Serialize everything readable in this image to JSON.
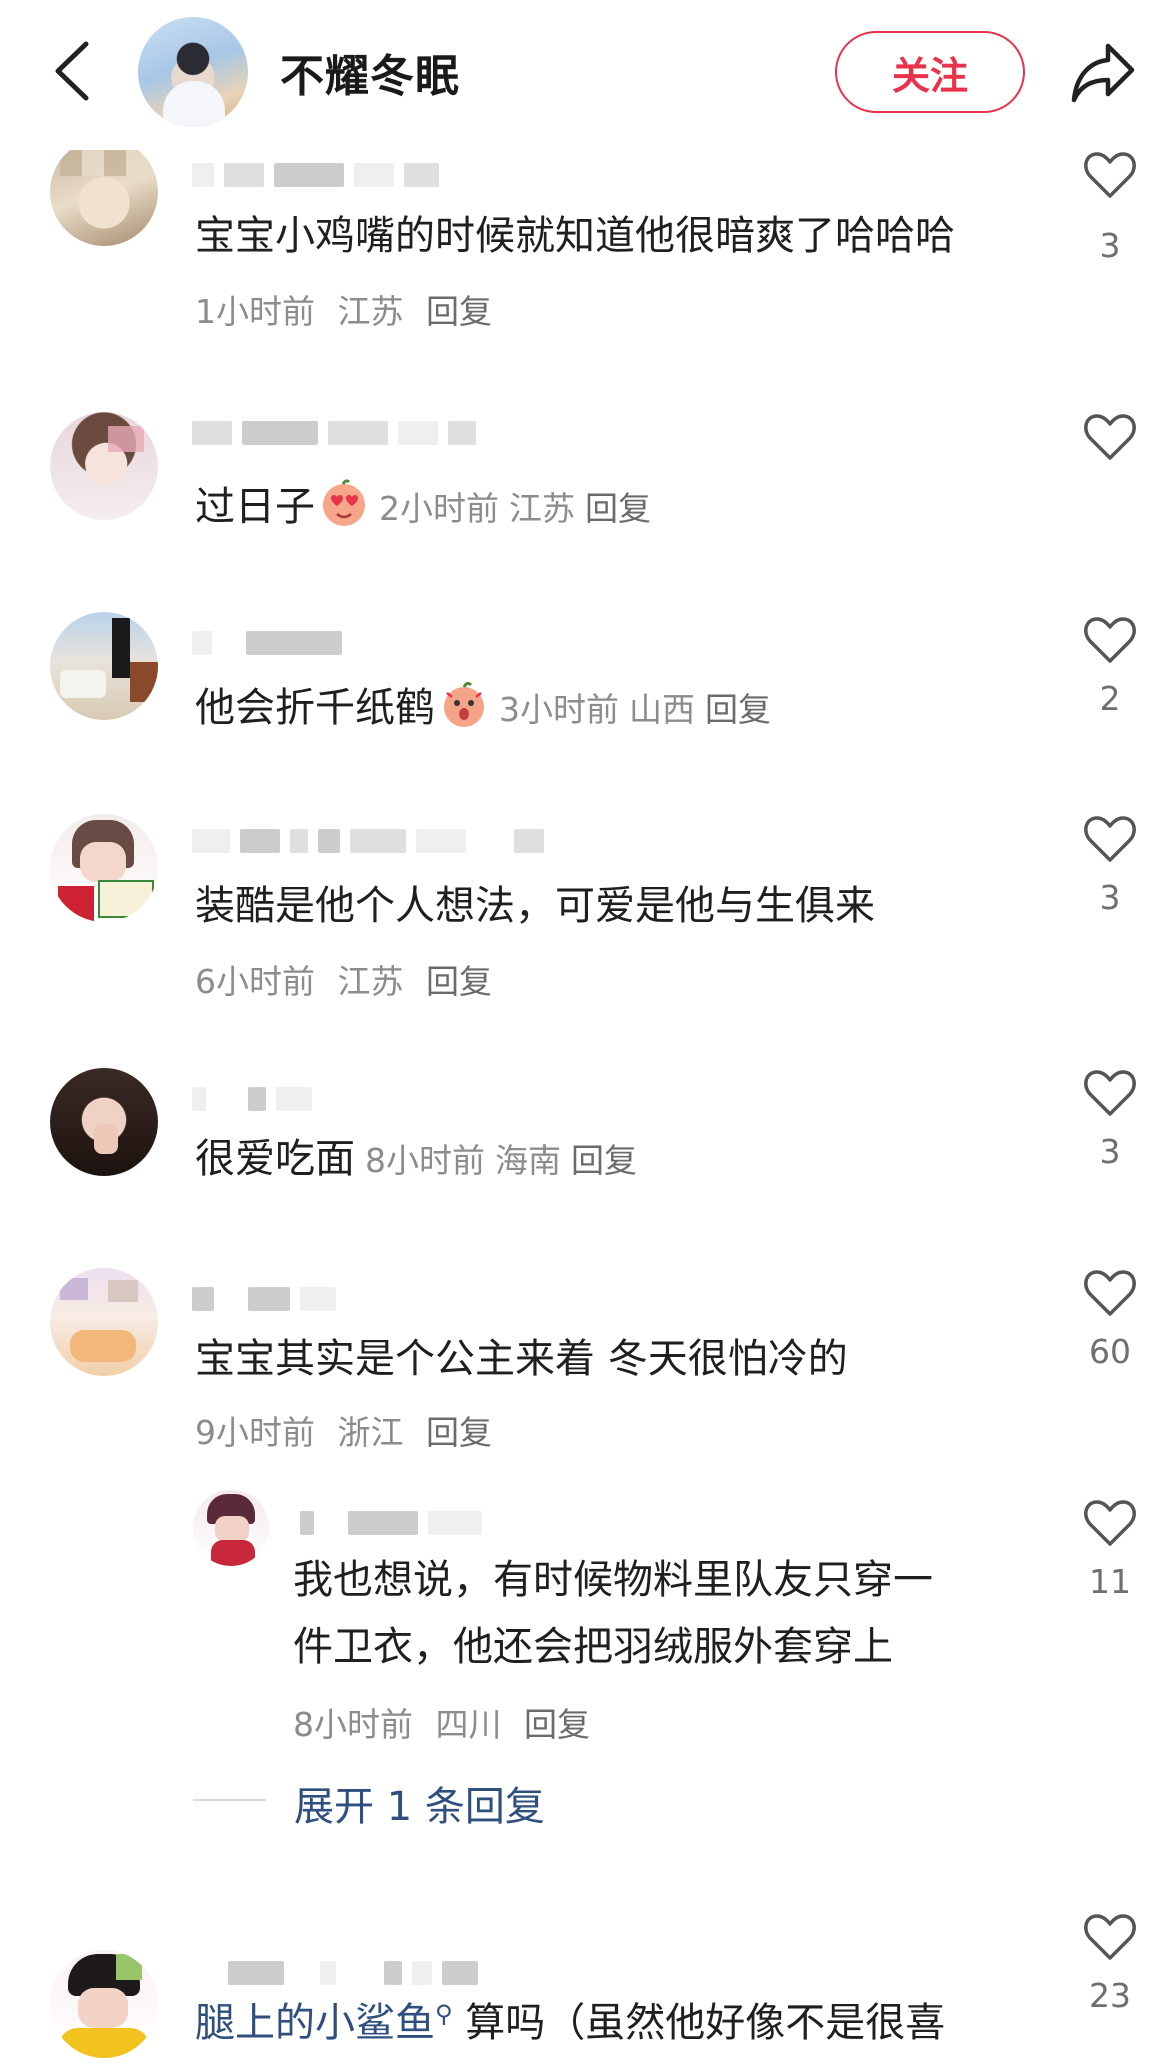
{
  "header": {
    "title": "不耀冬眠",
    "follow_label": "关注"
  },
  "comments": [
    {
      "content": "宝宝小鸡嘴的时候就知道他很暗爽了哈哈哈",
      "meta_time": "1小时前",
      "meta_location": "江苏",
      "reply_label": "回复",
      "likes": "3"
    },
    {
      "content": "过日子",
      "meta_time": "2小时前",
      "meta_location": "江苏",
      "reply_label": "回复",
      "likes": ""
    },
    {
      "content": "他会折千纸鹤",
      "meta_time": "3小时前",
      "meta_location": "山西",
      "reply_label": "回复",
      "likes": "2"
    },
    {
      "content": "装酷是他个人想法，可爱是他与生俱来",
      "meta_time": "6小时前",
      "meta_location": "江苏",
      "reply_label": "回复",
      "likes": "3"
    },
    {
      "content": "很爱吃面",
      "meta_time": "8小时前",
      "meta_location": "海南",
      "reply_label": "回复",
      "likes": "3"
    },
    {
      "content": "宝宝其实是个公主来着 冬天很怕冷的",
      "meta_time": "9小时前",
      "meta_location": "浙江",
      "reply_label": "回复",
      "likes": "60"
    }
  ],
  "reply": {
    "line1": "我也想说，有时候物料里队友只穿一",
    "line2": "件卫衣，他还会把羽绒服外套穿上",
    "meta_time": "8小时前",
    "meta_location": "四川",
    "reply_label": "回复",
    "likes": "11",
    "expand_label": "展开 1 条回复"
  },
  "last_comment": {
    "mention": "腿上的小鲨鱼",
    "content": "算吗（虽然他好像不是很喜",
    "likes": "23"
  },
  "icons": {
    "back": "chevron-left-icon",
    "share": "share-arrow-icon",
    "like": "heart-outline-icon",
    "emoji_love": "heart-eyes-emoji",
    "emoji_shock": "shocked-emoji",
    "mention": "search-icon"
  },
  "colors": {
    "accent": "#e8334a",
    "link": "#2f4f7f",
    "meta": "#8c8c8c"
  }
}
